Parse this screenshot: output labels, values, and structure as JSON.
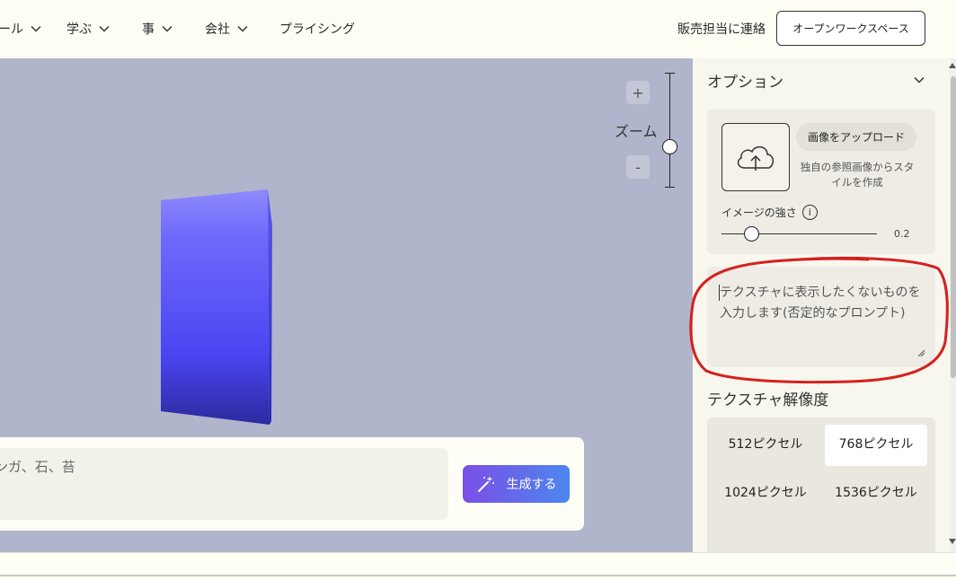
{
  "nav": {
    "items": [
      {
        "label": "ール"
      },
      {
        "label": "学ぶ"
      },
      {
        "label": "事"
      },
      {
        "label": "会社"
      },
      {
        "label": "プライシング"
      }
    ],
    "contact_sales": "販売担当に連絡",
    "open_workspace": "オープンワークスペース"
  },
  "viewport": {
    "zoom_label": "ズーム",
    "zoom_plus": "+",
    "zoom_minus": "-",
    "prompt_text": "ンガ、石、苔",
    "generate_label": "生成する",
    "box_color": "#4a45f2"
  },
  "options": {
    "title": "オプション",
    "upload_button": "画像をアップロード",
    "upload_desc": "独自の参照画像からスタイルを作成",
    "strength_label": "イメージの強さ",
    "strength_value": "0.2",
    "negative_placeholder": "テクスチャに表示したくないものを入力します(否定的なプロンプト)",
    "resolution_title": "テクスチャ解像度",
    "resolutions": [
      {
        "label": "512ピクセル",
        "selected": false
      },
      {
        "label": "768ピクセル",
        "selected": true
      },
      {
        "label": "1024ピクセル",
        "selected": false
      },
      {
        "label": "1536ピクセル",
        "selected": false
      }
    ]
  },
  "colors": {
    "viewport_bg": "#b0b5cb",
    "annotation_red": "#d62020",
    "generate_gradient_start": "#7b4fe6",
    "generate_gradient_end": "#4d86ef"
  }
}
